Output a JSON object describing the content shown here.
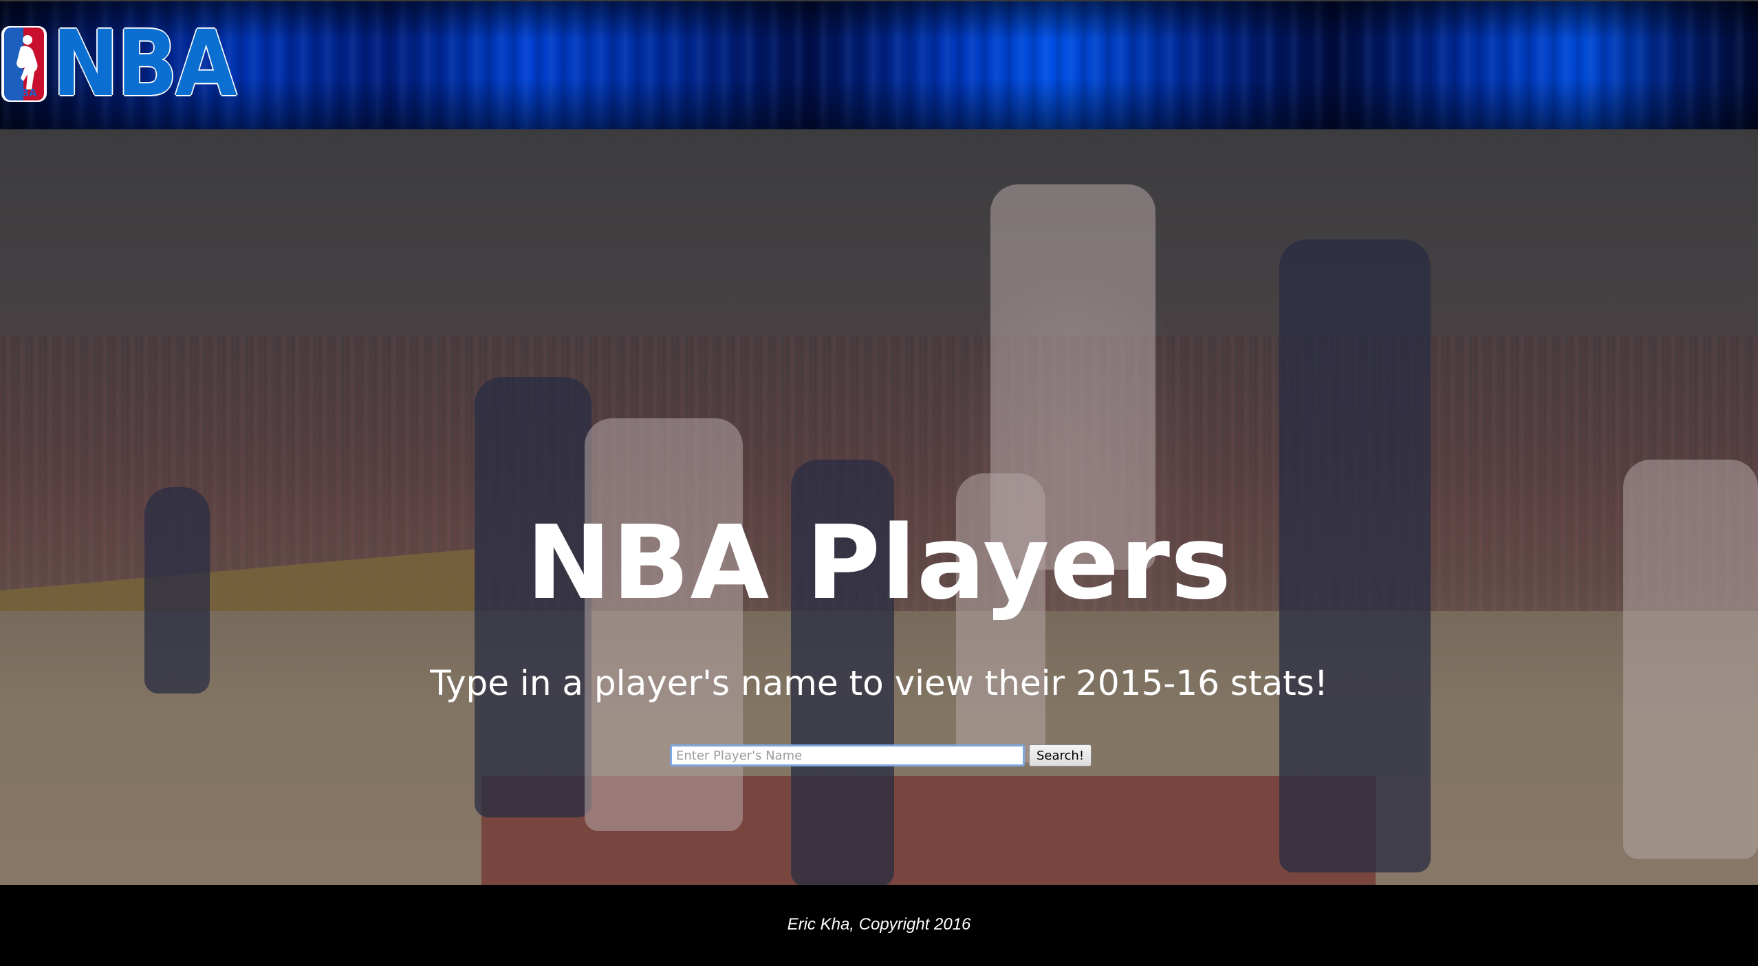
{
  "header": {
    "logo_text": "NBA",
    "logo_badge_text": "NBA"
  },
  "hero": {
    "title": "NBA Players",
    "subtitle": "Type in a player's name to view their 2015-16 stats!"
  },
  "search": {
    "placeholder": "Enter Player's Name",
    "value": "",
    "button_label": "Search!"
  },
  "footer": {
    "text": "Eric Kha, Copyright 2016"
  },
  "colors": {
    "header_blue": "#0033b3",
    "logo_blue": "#0a6fd1",
    "logo_red": "#c8102e",
    "footer_bg": "#000000"
  }
}
